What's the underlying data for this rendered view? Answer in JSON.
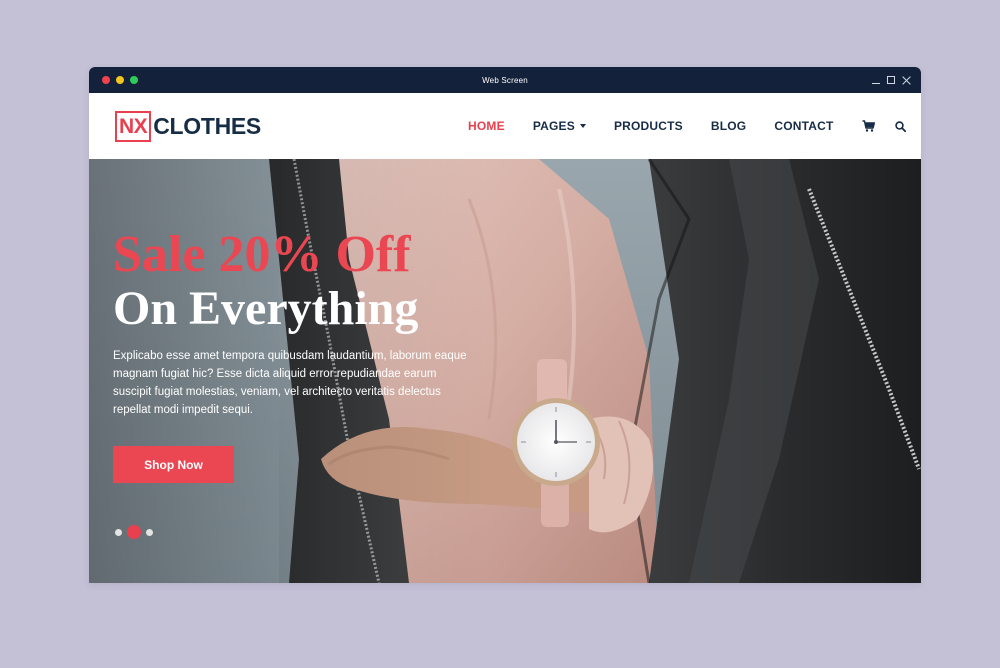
{
  "window": {
    "title": "Web Screen",
    "controls": [
      "minimize-icon",
      "maximize-icon",
      "close-icon"
    ]
  },
  "logo": {
    "box_text": "NX",
    "text": "CLOTHES"
  },
  "nav": {
    "items": [
      {
        "label": "HOME",
        "active": true
      },
      {
        "label": "PAGES",
        "active": false,
        "dropdown": true
      },
      {
        "label": "PRODUCTS",
        "active": false
      },
      {
        "label": "BLOG",
        "active": false
      },
      {
        "label": "CONTACT",
        "active": false
      }
    ],
    "icons": [
      "cart-icon",
      "search-icon"
    ]
  },
  "hero": {
    "headline_line1": "Sale 20% Off",
    "headline_line2": "On Everything",
    "description": "Explicabo esse amet tempora quibusdam laudantium, laborum eaque magnam fugiat hic? Esse dicta aliquid error repudiandae earum suscipit fugiat molestias, veniam, vel architecto veritatis delectus repellat modi impedit sequi.",
    "button_label": "Shop Now",
    "slider": {
      "count": 3,
      "active_index": 1
    }
  },
  "colors": {
    "accent": "#e8404f",
    "navy": "#172c45",
    "titlebar": "#14213a",
    "page_bg": "#c4c1d7"
  }
}
